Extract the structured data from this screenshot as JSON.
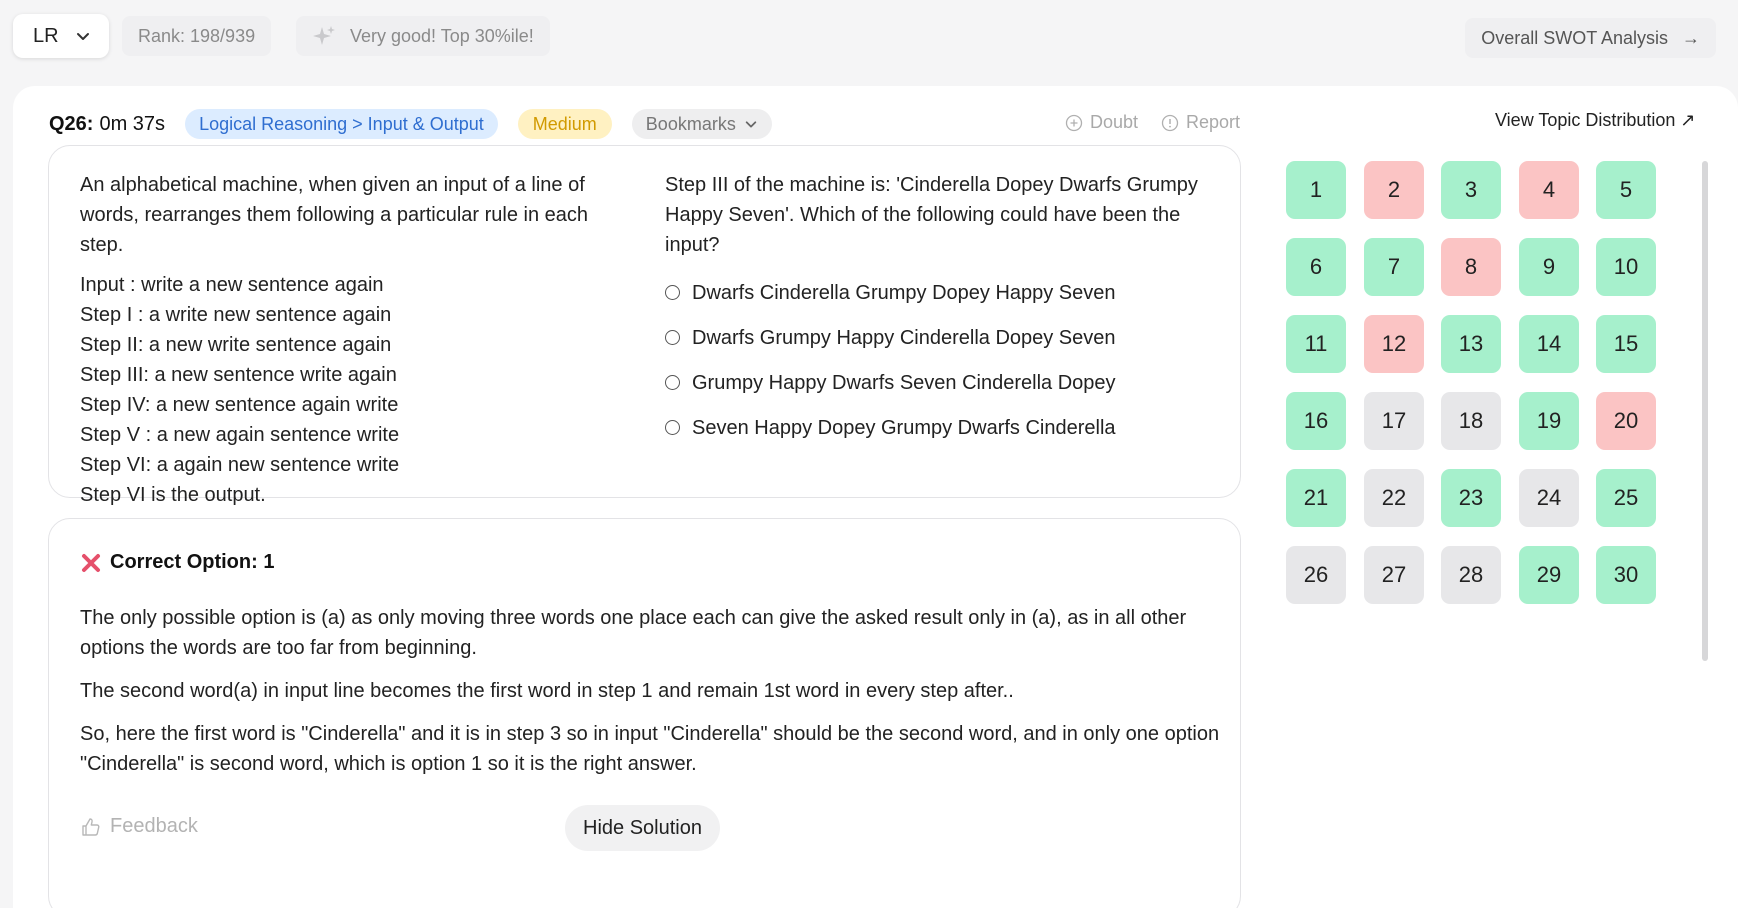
{
  "topbar": {
    "subject": "LR",
    "rank": "Rank: 198/939",
    "percentile": "Very good! Top 30%ile!",
    "swot": "Overall SWOT Analysis",
    "swot_arrow": "→"
  },
  "question": {
    "number": "Q26:",
    "time": "0m 37s",
    "topic": "Logical Reasoning > Input & Output",
    "difficulty": "Medium",
    "bookmarks": "Bookmarks",
    "doubt": "Doubt",
    "report": "Report",
    "topic_distribution": "View Topic Distribution ↗",
    "intro": "An alphabetical machine, when given an input of a line of words, rearranges them following a particular rule in each step.",
    "steps": [
      "Input : write a new sentence again",
      "Step I : a write new sentence again",
      "Step II: a new write sentence again",
      "Step III: a new sentence write again",
      "Step IV: a new sentence again write",
      "Step V : a new again sentence write",
      "Step VI: a again new sentence write",
      "Step VI is the output."
    ],
    "stem": "Step III of the machine is: 'Cinderella Dopey Dwarfs Grumpy Happy Seven'. Which of the following could have been the input?",
    "options": [
      "Dwarfs Cinderella Grumpy Dopey Happy Seven",
      "Dwarfs Grumpy Happy Cinderella Dopey Seven",
      "Grumpy Happy Dwarfs Seven Cinderella Dopey",
      "Seven Happy Dopey Grumpy Dwarfs Cinderella"
    ]
  },
  "solution": {
    "correct_option": "Correct Option: 1",
    "paragraphs": [
      "The only possible option is (a) as only moving three words one place each can give the asked result only in (a), as in all other options the words are too far from beginning.",
      "The second word(a) in input line becomes the first word in step 1 and remain 1st word in every step after..",
      "So, here the first word is \"Cinderella\" and it is in step 3 so in input \"Cinderella\" should be the second word, and in only one option \"Cinderella\" is second word, which is option 1 so it is the right answer."
    ],
    "feedback": "Feedback",
    "hide": "Hide Solution"
  },
  "colors": {
    "correct": "#a6f0cc",
    "wrong": "#fbc4c4",
    "skipped": "#e7e7e9",
    "topic_tag": "#dcecff",
    "difficulty_tag": "#fff1c2"
  },
  "grid": [
    {
      "n": "1",
      "s": "correct"
    },
    {
      "n": "2",
      "s": "wrong"
    },
    {
      "n": "3",
      "s": "correct"
    },
    {
      "n": "4",
      "s": "wrong"
    },
    {
      "n": "5",
      "s": "correct"
    },
    {
      "n": "6",
      "s": "correct"
    },
    {
      "n": "7",
      "s": "correct"
    },
    {
      "n": "8",
      "s": "wrong"
    },
    {
      "n": "9",
      "s": "correct"
    },
    {
      "n": "10",
      "s": "correct"
    },
    {
      "n": "11",
      "s": "correct"
    },
    {
      "n": "12",
      "s": "wrong"
    },
    {
      "n": "13",
      "s": "correct"
    },
    {
      "n": "14",
      "s": "correct"
    },
    {
      "n": "15",
      "s": "correct"
    },
    {
      "n": "16",
      "s": "correct"
    },
    {
      "n": "17",
      "s": "skipped"
    },
    {
      "n": "18",
      "s": "skipped"
    },
    {
      "n": "19",
      "s": "correct"
    },
    {
      "n": "20",
      "s": "wrong"
    },
    {
      "n": "21",
      "s": "correct"
    },
    {
      "n": "22",
      "s": "skipped"
    },
    {
      "n": "23",
      "s": "correct"
    },
    {
      "n": "24",
      "s": "skipped"
    },
    {
      "n": "25",
      "s": "correct"
    },
    {
      "n": "26",
      "s": "skipped"
    },
    {
      "n": "27",
      "s": "skipped"
    },
    {
      "n": "28",
      "s": "skipped"
    },
    {
      "n": "29",
      "s": "correct"
    },
    {
      "n": "30",
      "s": "correct"
    }
  ]
}
